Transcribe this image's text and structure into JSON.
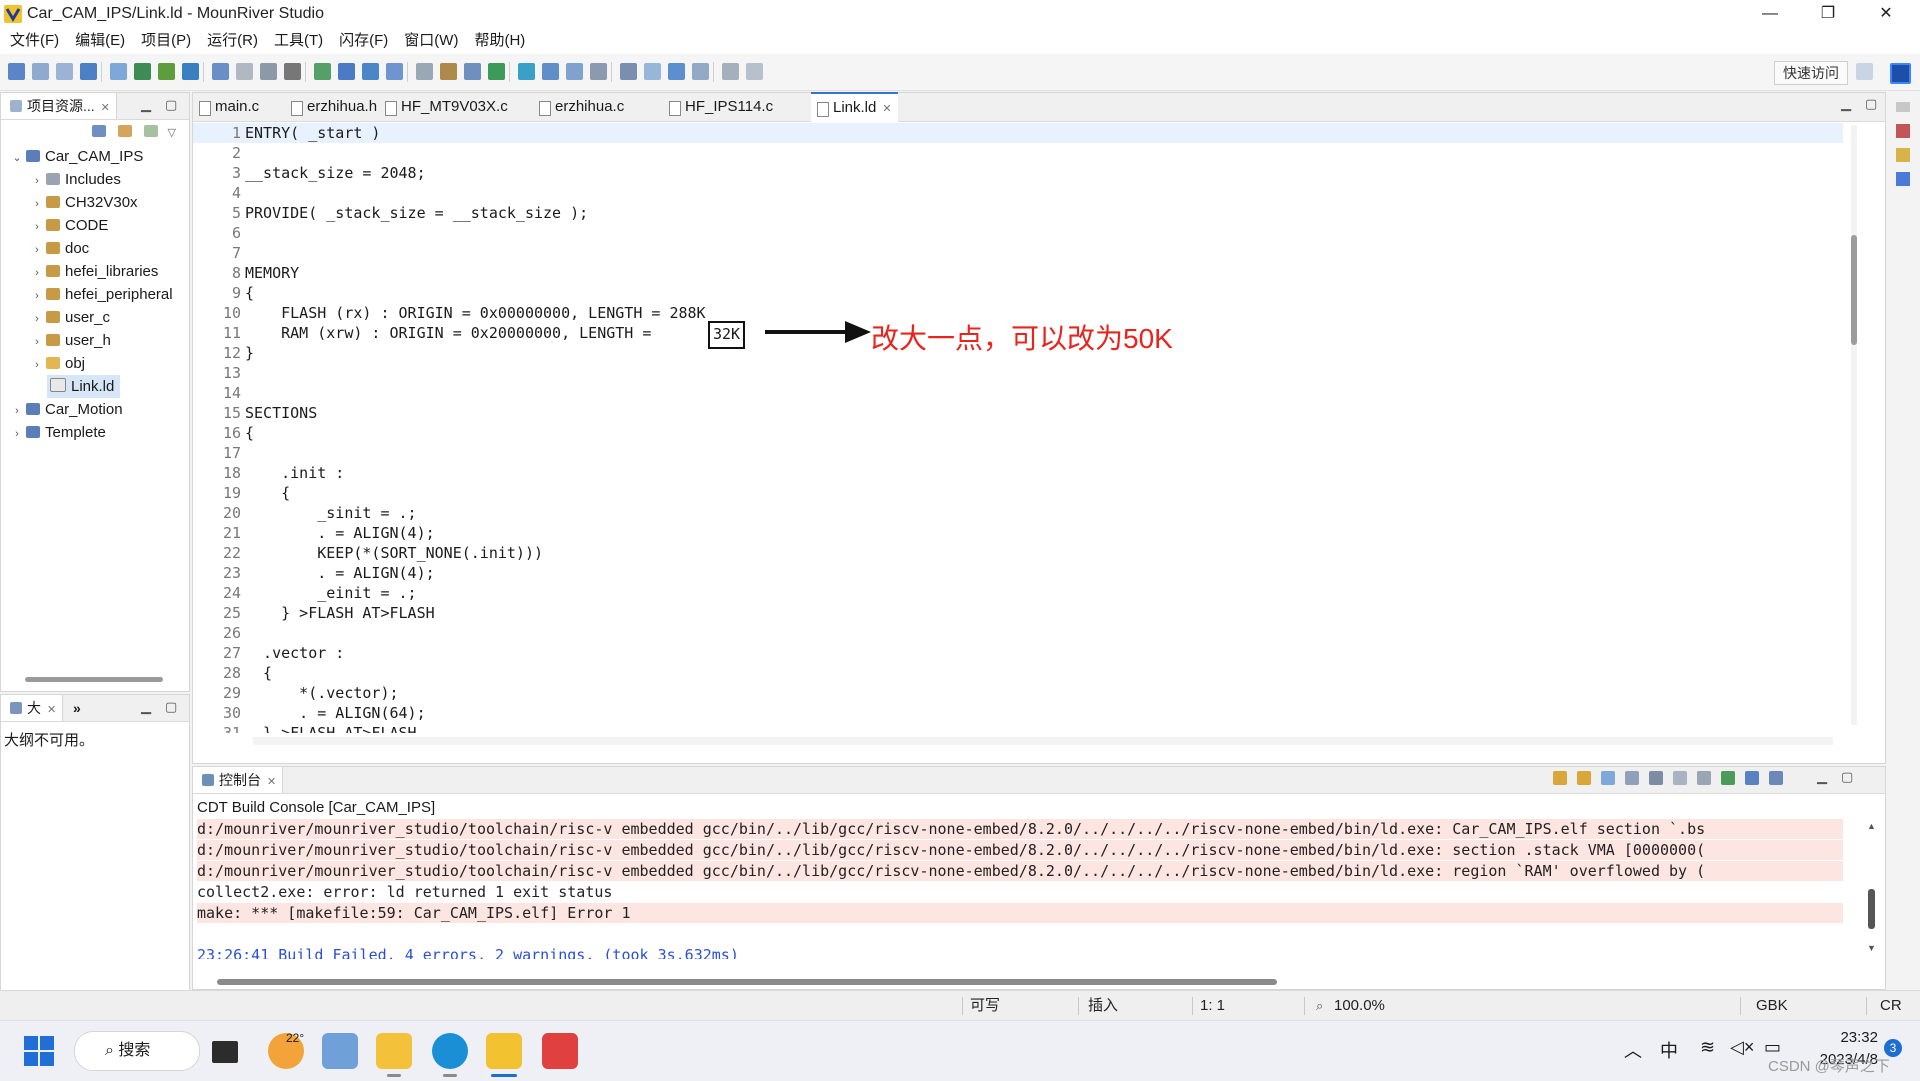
{
  "window": {
    "title": "Car_CAM_IPS/Link.ld - MounRiver Studio",
    "controls": {
      "minimize": "—",
      "restore": "❐",
      "close": "✕"
    }
  },
  "menu": [
    "文件(F)",
    "编辑(E)",
    "项目(P)",
    "运行(R)",
    "工具(T)",
    "闪存(F)",
    "窗口(W)",
    "帮助(H)"
  ],
  "toolbar": {
    "quick_access": "快速访问"
  },
  "project_explorer": {
    "tab_label": "项目资源...",
    "tree": [
      {
        "label": "Car_CAM_IPS",
        "expanded": true,
        "icon": "project-icon"
      },
      {
        "label": "Includes",
        "icon": "includes-icon"
      },
      {
        "label": "CH32V30x",
        "icon": "source-folder-icon"
      },
      {
        "label": "CODE",
        "icon": "source-folder-icon"
      },
      {
        "label": "doc",
        "icon": "source-folder-icon"
      },
      {
        "label": "hefei_libraries",
        "icon": "source-folder-icon"
      },
      {
        "label": "hefei_peripheral",
        "icon": "source-folder-icon"
      },
      {
        "label": "user_c",
        "icon": "source-folder-icon"
      },
      {
        "label": "user_h",
        "icon": "source-folder-icon"
      },
      {
        "label": "obj",
        "icon": "folder-icon"
      },
      {
        "label": "Link.ld",
        "icon": "file-icon",
        "selected": true
      },
      {
        "label": "Car_Motion",
        "icon": "project-icon"
      },
      {
        "label": "Templete",
        "icon": "project-icon"
      }
    ]
  },
  "outline": {
    "tab_label": "大",
    "overflow": "»",
    "message": "大纲不可用。"
  },
  "editor": {
    "tabs": [
      "main.c",
      "erzhihua.h",
      "HF_MT9V03X.c",
      "erzhihua.c",
      "HF_IPS114.c",
      "Link.ld"
    ],
    "active_tab": "Link.ld",
    "lines": [
      "ENTRY( _start )",
      "",
      "__stack_size = 2048;",
      "",
      "PROVIDE( _stack_size = __stack_size );",
      "",
      "",
      "MEMORY",
      "{",
      "    FLASH (rx) : ORIGIN = 0x00000000, LENGTH = 288K",
      "    RAM (xrw) : ORIGIN = 0x20000000, LENGTH = ",
      "}",
      "",
      "",
      "SECTIONS",
      "{",
      "",
      "    .init :",
      "    {",
      "        _sinit = .;",
      "        . = ALIGN(4);",
      "        KEEP(*(SORT_NONE(.init)))",
      "        . = ALIGN(4);",
      "        _einit = .;",
      "    } >FLASH AT>FLASH",
      "",
      "  .vector :",
      "  {",
      "      *(.vector);",
      "      . = ALIGN(64);",
      "  } >FLASH AT>FLASH"
    ],
    "highlight_value": "32K",
    "annotation": "改大一点，可以改为50K",
    "annotation_color": "#e8241c"
  },
  "console": {
    "tab_label": "控制台",
    "header": "CDT Build Console [Car_CAM_IPS]",
    "lines": [
      {
        "text": "d:/mounriver/mounriver_studio/toolchain/risc-v embedded gcc/bin/../lib/gcc/riscv-none-embed/8.2.0/../../../../riscv-none-embed/bin/ld.exe: Car_CAM_IPS.elf section `.bs",
        "kind": "err"
      },
      {
        "text": "d:/mounriver/mounriver_studio/toolchain/risc-v embedded gcc/bin/../lib/gcc/riscv-none-embed/8.2.0/../../../../riscv-none-embed/bin/ld.exe: section .stack VMA [0000000(",
        "kind": "err"
      },
      {
        "text": "d:/mounriver/mounriver_studio/toolchain/risc-v embedded gcc/bin/../lib/gcc/riscv-none-embed/8.2.0/../../../../riscv-none-embed/bin/ld.exe: region `RAM' overflowed by (",
        "kind": "err"
      },
      {
        "text": "collect2.exe: error: ld returned 1 exit status",
        "kind": "plain"
      },
      {
        "text": "make: *** [makefile:59: Car_CAM_IPS.elf] Error 1",
        "kind": "err"
      },
      {
        "text": "",
        "kind": "plain"
      },
      {
        "text": "23:26:41 Build Failed. 4 errors, 2 warnings. (took 3s.632ms)",
        "kind": "info"
      }
    ]
  },
  "statusbar": {
    "writable": "可写",
    "insert_mode": "插入",
    "position": "1: 1",
    "zoom": "100.0%",
    "encoding": "GBK",
    "line_ending": "CR"
  },
  "taskbar": {
    "search": "搜索",
    "weather_temp": "22°",
    "tray_lang": "中",
    "clock_time": "23:32",
    "clock_date": "2023/4/8",
    "notification_count": "3",
    "watermark": "CSDN @琴声之下"
  },
  "colors": {
    "accent": "#3574c8",
    "error_bg": "#fde5e2",
    "info_text": "#2a4fd6",
    "annotation_red": "#e8241c"
  }
}
